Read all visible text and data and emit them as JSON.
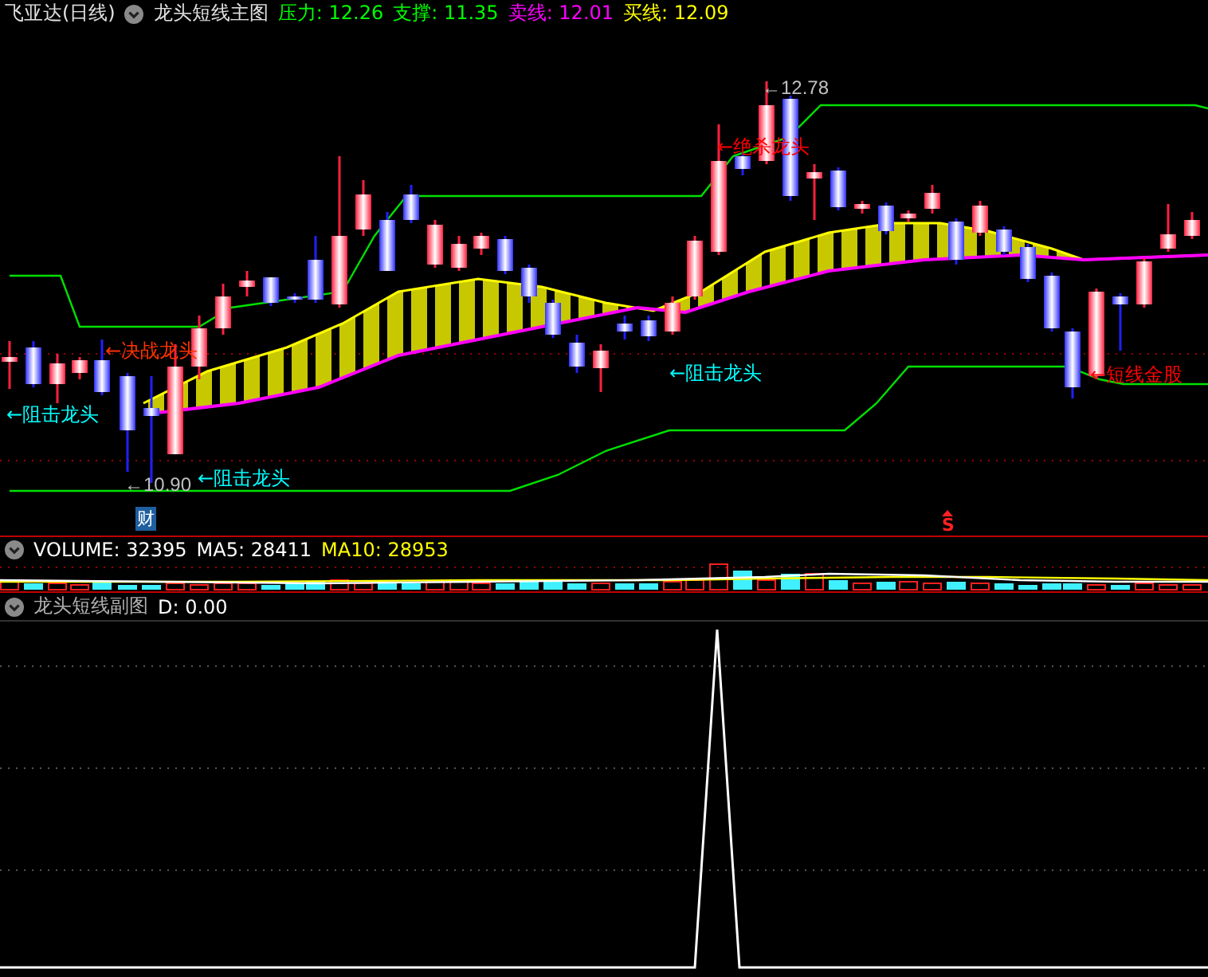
{
  "header": {
    "title": "飞亚达(日线)",
    "indicator": "龙头短线主图",
    "readings": [
      {
        "text": "压力: 12.26",
        "color": "#00ff00"
      },
      {
        "text": "支撑: 11.35",
        "color": "#00ff00"
      },
      {
        "text": "卖线: 12.01",
        "color": "#ff00ff"
      },
      {
        "text": "买线: 12.09",
        "color": "#ffff00"
      }
    ]
  },
  "main_chart": {
    "annotations": [
      {
        "text": "←决战龙头",
        "kind": "signal",
        "color": "#ff3300"
      },
      {
        "text": "←阻击龙头",
        "kind": "signal",
        "color": "#00ffff"
      },
      {
        "text": "←10.90",
        "kind": "price",
        "color": "#c0c0c0"
      },
      {
        "text": "←阻击龙头",
        "kind": "signal",
        "color": "#00ffff"
      },
      {
        "text": "←绝杀龙头",
        "kind": "signal",
        "color": "#ff0000"
      },
      {
        "text": "←12.78",
        "kind": "price",
        "color": "#c0c0c0"
      },
      {
        "text": "←阻击龙头",
        "kind": "signal",
        "color": "#00ffff"
      },
      {
        "text": "←短线金股",
        "kind": "signal",
        "color": "#ff0000"
      }
    ],
    "markers": [
      {
        "text": "财",
        "kind": "badge"
      },
      {
        "text": "S",
        "kind": "arrow"
      }
    ]
  },
  "volume": {
    "readings": [
      {
        "text": "VOLUME: 32395",
        "color": "#ffffff"
      },
      {
        "text": "MA5: 28411",
        "color": "#ffffff"
      },
      {
        "text": "MA10: 28953",
        "color": "#ffff00"
      }
    ]
  },
  "sub_chart": {
    "title": "龙头短线副图",
    "readings": [
      {
        "text": "D: 0.00",
        "color": "#ffffff"
      }
    ]
  }
}
